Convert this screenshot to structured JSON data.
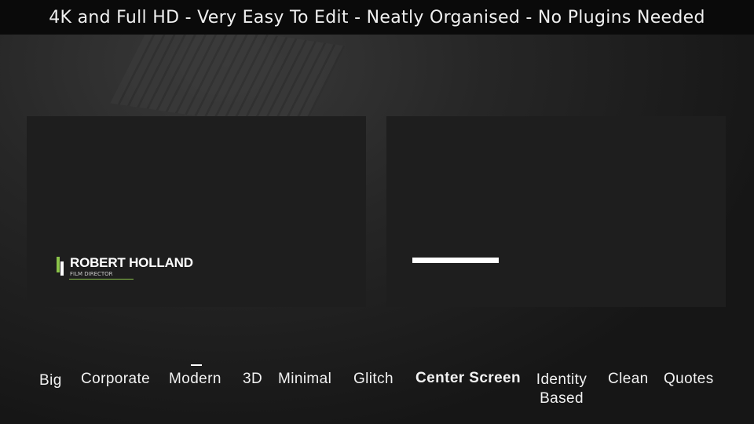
{
  "banner": {
    "text": "4K and Full HD - Very Easy To Edit - Neatly Organised - No Plugins Needed"
  },
  "preview_left": {
    "name": "ROBERT HOLLAND",
    "role": "FILM DIRECTOR",
    "accent": "#8bc34a"
  },
  "preview_right": {},
  "categories": [
    {
      "label": "Big"
    },
    {
      "label": "Corporate"
    },
    {
      "label": "Modern"
    },
    {
      "label": "3D"
    },
    {
      "label": "Minimal"
    },
    {
      "label": "Glitch"
    },
    {
      "label": "Center Screen",
      "active": true
    },
    {
      "label": "Identity Based"
    },
    {
      "label": "Clean"
    },
    {
      "label": "Quotes"
    }
  ]
}
